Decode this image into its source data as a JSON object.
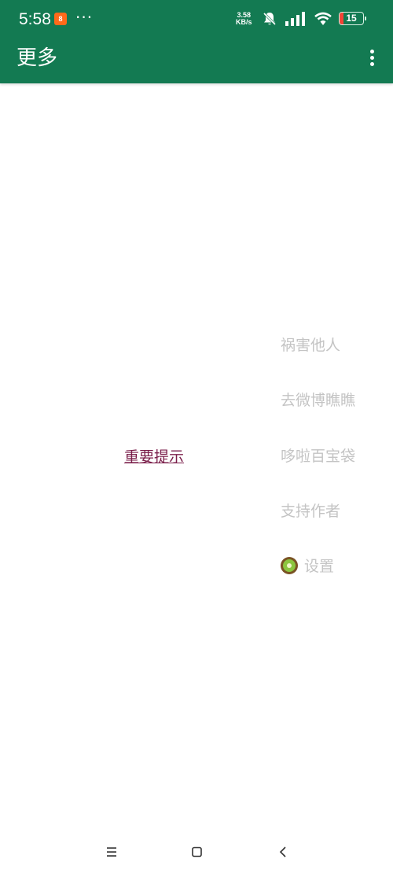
{
  "status_bar": {
    "time": "5:58",
    "app_badge": "8",
    "more_indicator": "···",
    "net_speed_value": "3.58",
    "net_speed_unit": "KB/s",
    "battery_level": "15",
    "battery_fraction": 0.15,
    "icons": [
      "notifications-off-icon",
      "signal-icon",
      "wifi-icon",
      "battery-icon"
    ]
  },
  "app_bar": {
    "title": "更多",
    "overflow_icon": "more-vert-icon"
  },
  "main": {
    "notice_link": "重要提示",
    "menu": [
      {
        "label": "祸害他人"
      },
      {
        "label": "去微博瞧瞧"
      },
      {
        "label": "哆啦百宝袋"
      },
      {
        "label": "支持作者"
      },
      {
        "label": "设置",
        "icon": "kiwi-icon"
      }
    ]
  },
  "nav_bar": {
    "buttons": [
      "menu-icon",
      "home-icon",
      "back-icon"
    ]
  },
  "colors": {
    "primary": "#137a52",
    "link": "#7a1e4a",
    "menu_text": "#c4c4c4",
    "battery_low": "#f44336"
  }
}
